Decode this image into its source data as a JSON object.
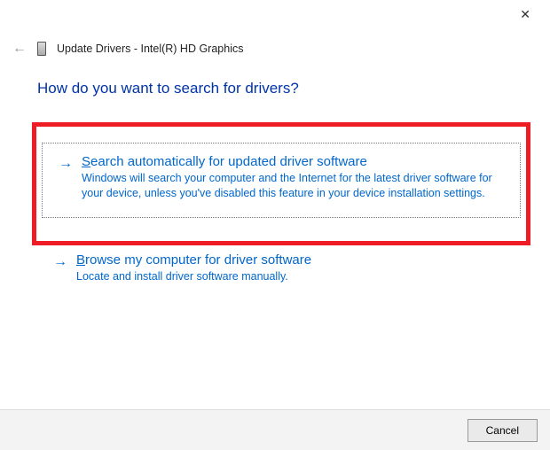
{
  "titlebar": {
    "close_glyph": "✕"
  },
  "header": {
    "back_glyph": "←",
    "title": "Update Drivers - Intel(R) HD Graphics"
  },
  "main": {
    "heading": "How do you want to search for drivers?",
    "option1": {
      "arrow": "→",
      "title_char": "S",
      "title_rest": "earch automatically for updated driver software",
      "description": "Windows will search your computer and the Internet for the latest driver software for your device, unless you've disabled this feature in your device installation settings."
    },
    "option2": {
      "arrow": "→",
      "title_char": "B",
      "title_rest": "rowse my computer for driver software",
      "description": "Locate and install driver software manually."
    }
  },
  "footer": {
    "cancel_label": "Cancel"
  }
}
